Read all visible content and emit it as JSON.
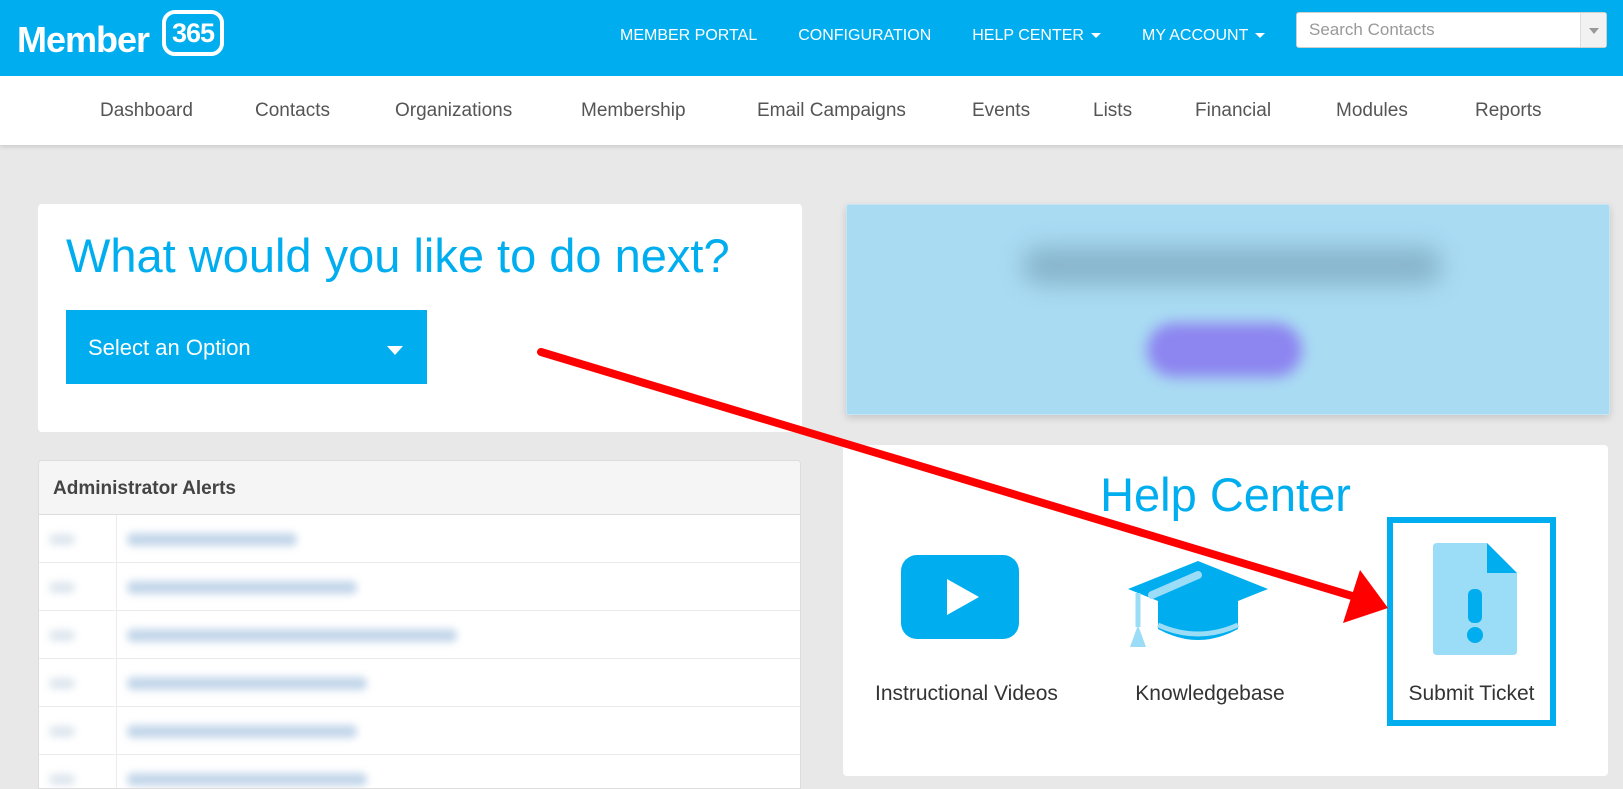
{
  "brand": {
    "word": "Member",
    "badge": "365"
  },
  "topnav": {
    "member_portal": "MEMBER PORTAL",
    "configuration": "CONFIGURATION",
    "help_center": "HELP CENTER",
    "my_account": "MY ACCOUNT"
  },
  "search": {
    "placeholder": "Search Contacts"
  },
  "subnav": [
    "Dashboard",
    "Contacts",
    "Organizations",
    "Membership",
    "Email Campaigns",
    "Events",
    "Lists",
    "Financial",
    "Modules",
    "Reports"
  ],
  "next": {
    "headline": "What would you like to do next?",
    "select_label": "Select an Option"
  },
  "alerts": {
    "title": "Administrator Alerts"
  },
  "help": {
    "title": "Help Center",
    "items": {
      "videos": "Instructional Videos",
      "kb": "Knowledgebase",
      "ticket": "Submit Ticket"
    }
  },
  "colors": {
    "brand": "#00aeef",
    "annotation": "#ff0000",
    "icon_light": "#9bdcf7"
  }
}
